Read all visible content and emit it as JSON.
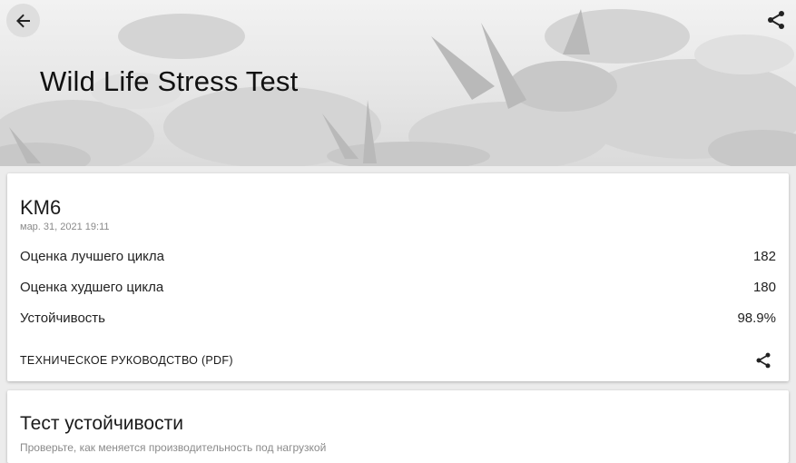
{
  "header": {
    "title": "Wild Life Stress Test",
    "back_icon": "arrow-back-icon",
    "share_icon": "share-icon"
  },
  "result_card": {
    "device_name": "KM6",
    "date": "мар. 31, 2021 19:11",
    "rows": [
      {
        "label": "Оценка лучшего цикла",
        "value": "182"
      },
      {
        "label": "Оценка худшего цикла",
        "value": "180"
      },
      {
        "label": "Устойчивость",
        "value": "98.9%"
      }
    ],
    "guide_link": "ТЕХНИЧЕСКОЕ РУКОВОДСТВО (PDF)",
    "share_icon": "share-icon"
  },
  "stability_card": {
    "title": "Тест устойчивости",
    "description": "Проверьте, как меняется производительность под нагрузкой"
  },
  "colors": {
    "background": "#ececec",
    "card": "#ffffff",
    "text": "#202020",
    "secondary_text": "#8a8a8a"
  }
}
